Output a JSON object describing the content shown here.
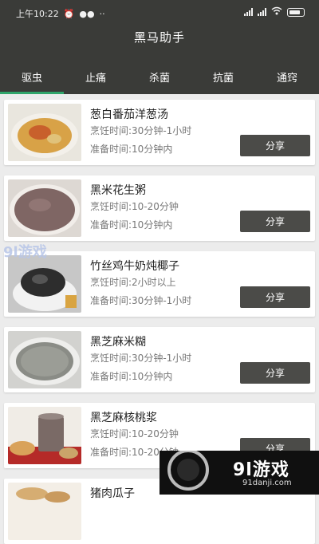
{
  "status_bar": {
    "time": "上午10:22",
    "battery": "85"
  },
  "header": {
    "title": "黑马助手"
  },
  "tabs": [
    {
      "label": "驱虫"
    },
    {
      "label": "止痛"
    },
    {
      "label": "杀菌"
    },
    {
      "label": "抗菌"
    },
    {
      "label": "通窍"
    }
  ],
  "recipes": [
    {
      "name": "葱白番茄洋葱汤",
      "cook_time": "烹饪时间:30分钟-1小时",
      "prep_time": "准备时间:10分钟内",
      "share_label": "分享"
    },
    {
      "name": "黑米花生粥",
      "cook_time": "烹饪时间:10-20分钟",
      "prep_time": "准备时间:10分钟内",
      "share_label": "分享"
    },
    {
      "name": "竹丝鸡牛奶炖椰子",
      "cook_time": "烹饪时间:2小时以上",
      "prep_time": "准备时间:30分钟-1小时",
      "share_label": "分享"
    },
    {
      "name": "黑芝麻米糊",
      "cook_time": "烹饪时间:30分钟-1小时",
      "prep_time": "准备时间:10分钟内",
      "share_label": "分享"
    },
    {
      "name": "黑芝麻核桃浆",
      "cook_time": "烹饪时间:10-20分钟",
      "prep_time": "准备时间:10-20分钟",
      "share_label": "分享"
    },
    {
      "name": "猪肉瓜子"
    }
  ],
  "watermark": {
    "left_text": "9l游戏",
    "brand": "9l游戏",
    "url": "91danji.com"
  },
  "colors": {
    "header_bg": "#3a3b38",
    "tab_indicator": "#2fa56b",
    "share_button": "#4b4b48"
  }
}
